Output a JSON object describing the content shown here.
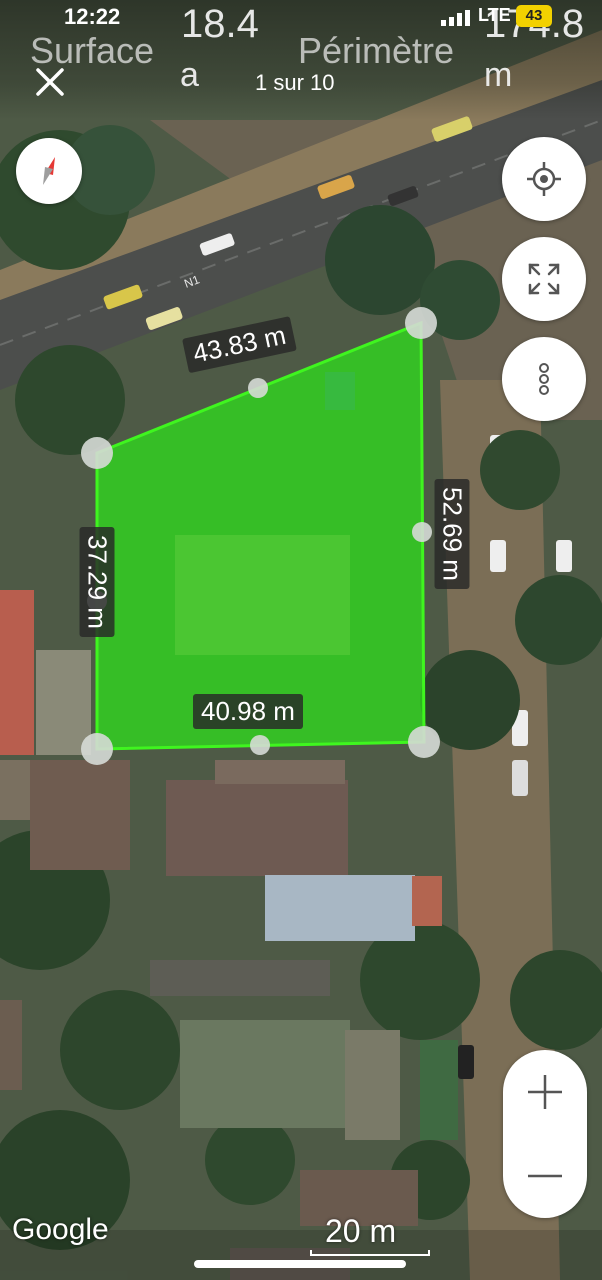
{
  "status": {
    "time": "12:22",
    "network": "LTE",
    "battery": "43"
  },
  "measure": {
    "surface_label": "Surface",
    "surface_value": "18.4",
    "surface_unit": "a",
    "perimetre_label": "Périmètre",
    "perimetre_value": "174.8",
    "perimetre_unit": "m",
    "page_indicator": "1 sur 10"
  },
  "edges": {
    "top": "43.83 m",
    "right": "52.69 m",
    "bottom": "40.98 m",
    "left": "37.29 m"
  },
  "map": {
    "road_label": "N1",
    "attribution": "Google",
    "scale": "20 m",
    "polygon_color": "#35e81f"
  },
  "icons": {
    "close": "close-icon",
    "compass": "compass-icon",
    "locate": "locate-icon",
    "fullscreen": "fullscreen-icon",
    "more": "more-icon",
    "zoom_in": "plus-icon",
    "zoom_out": "minus-icon"
  },
  "zoom": {
    "plus": "+",
    "minus": "–"
  }
}
